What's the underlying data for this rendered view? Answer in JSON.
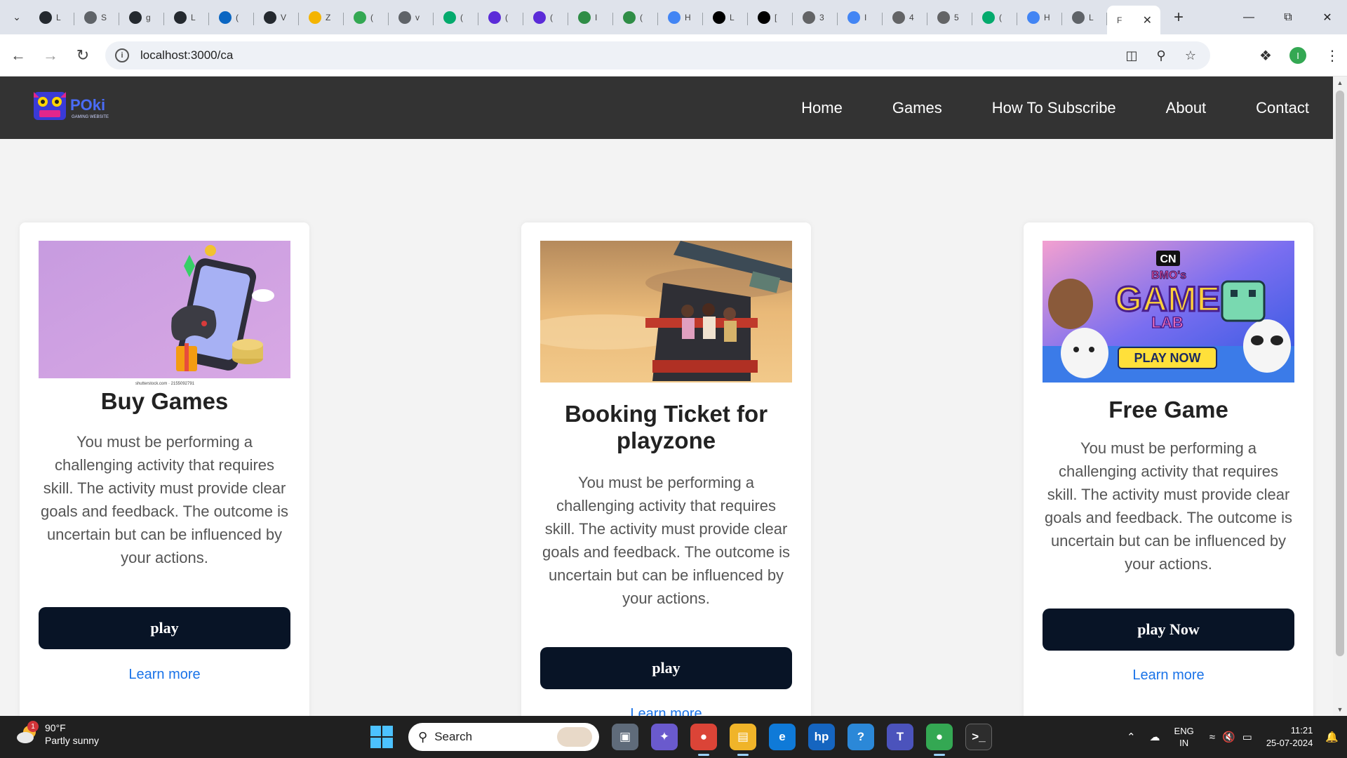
{
  "browser": {
    "tabs": [
      {
        "fav": "github-favicon",
        "letter": "L",
        "color": "#24292f"
      },
      {
        "fav": "globe-favicon",
        "letter": "S",
        "color": "#5f6368"
      },
      {
        "fav": "github-favicon",
        "letter": "g",
        "color": "#24292f"
      },
      {
        "fav": "github-favicon",
        "letter": "L",
        "color": "#24292f"
      },
      {
        "fav": "linkedin-favicon",
        "letter": "(",
        "color": "#0a66c2"
      },
      {
        "fav": "github-favicon",
        "letter": "V",
        "color": "#24292f"
      },
      {
        "fav": "zap-favicon",
        "letter": "Z",
        "color": "#f4b400"
      },
      {
        "fav": "green-favicon",
        "letter": "(",
        "color": "#34a853"
      },
      {
        "fav": "globe-favicon",
        "letter": "v",
        "color": "#5f6368"
      },
      {
        "fav": "w3-favicon",
        "letter": "(",
        "color": "#04aa6d"
      },
      {
        "fav": "p-favicon",
        "letter": "(",
        "color": "#5b2bd8"
      },
      {
        "fav": "p-favicon",
        "letter": "(",
        "color": "#5b2bd8"
      },
      {
        "fav": "gfg-favicon",
        "letter": "I",
        "color": "#2f8d46"
      },
      {
        "fav": "gfg-favicon",
        "letter": "(",
        "color": "#2f8d46"
      },
      {
        "fav": "google-favicon",
        "letter": "H",
        "color": "#4285f4"
      },
      {
        "fav": "hackernoon-favicon",
        "letter": "L",
        "color": "#000000"
      },
      {
        "fav": "hackernoon-favicon",
        "letter": "[",
        "color": "#000000"
      },
      {
        "fav": "w-favicon",
        "letter": "3",
        "color": "#636466"
      },
      {
        "fav": "google-favicon",
        "letter": "I",
        "color": "#4285f4"
      },
      {
        "fav": "w-favicon",
        "letter": "4",
        "color": "#636466"
      },
      {
        "fav": "w-favicon",
        "letter": "5",
        "color": "#636466"
      },
      {
        "fav": "w3-favicon",
        "letter": "(",
        "color": "#04aa6d"
      },
      {
        "fav": "google-favicon",
        "letter": "H",
        "color": "#4285f4"
      },
      {
        "fav": "globe-favicon",
        "letter": "L",
        "color": "#5f6368"
      }
    ],
    "active_tab_letter": "F",
    "url": "localhost:3000/ca"
  },
  "site": {
    "logo_text": "POki",
    "logo_subtext": "GAMING WEBSITE",
    "nav": [
      "Home",
      "Games",
      "How To Subscribe",
      "About",
      "Contact"
    ]
  },
  "cards": [
    {
      "title": "Buy Games",
      "desc": "You must be performing a challenging activity that requires skill. The activity must provide clear goals and feedback. The outcome is uncertain but can be influenced by your actions.",
      "button": "play",
      "link": "Learn more",
      "image_caption": "shutterstock.com · 2155092791"
    },
    {
      "title": "Booking Ticket for playzone",
      "desc": "You must be performing a challenging activity that requires skill. The activity must provide clear goals and feedback. The outcome is uncertain but can be influenced by your actions.",
      "button": "play",
      "link": "Learn more"
    },
    {
      "title": "Free Game",
      "desc": "You must be performing a challenging activity that requires skill. The activity must provide clear goals and feedback. The outcome is uncertain but can be influenced by your actions.",
      "button": "play Now",
      "link": "Learn more",
      "image_text": {
        "brand": "CN",
        "line1": "BMO's",
        "line2": "GAME",
        "line3": "LAB",
        "cta": "PLAY NOW"
      }
    }
  ],
  "taskbar": {
    "weather_temp": "90°F",
    "weather_desc": "Partly sunny",
    "weather_badge": "1",
    "search_placeholder": "Search",
    "lang_line1": "ENG",
    "lang_line2": "IN",
    "time": "11:21",
    "date": "25-07-2024"
  }
}
